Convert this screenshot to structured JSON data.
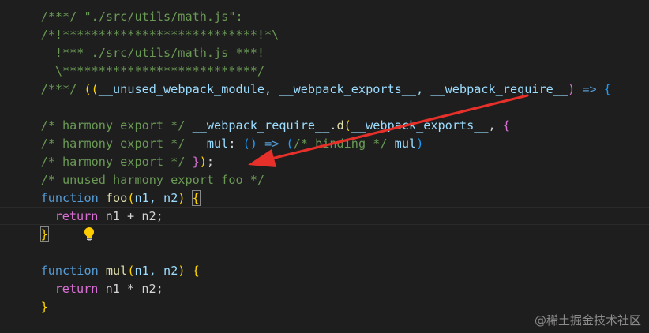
{
  "code": {
    "header_top": "/***/ \"./src/utils/math.js\":",
    "banner_1": "/*!***************************!*\\",
    "banner_2": "  !*** ./src/utils/math.js ***!",
    "banner_3": "  \\***************************/",
    "module_fn": {
      "prefix": "/***/ ",
      "open_parens": "((",
      "params": "__unused_webpack_module, __webpack_exports__, __webpack_require__",
      "close_paren": ")",
      "arrow": " => ",
      "brace": "{"
    },
    "export_1": {
      "comment": "/* harmony export */ ",
      "obj": "__webpack_require__",
      "dot": ".",
      "method": "d",
      "open": "(",
      "arg": "__webpack_exports__",
      "comma": ", ",
      "brace": "{"
    },
    "export_2": {
      "comment": "/* harmony export */   ",
      "key": "mul",
      "colon": ": ",
      "parens": "()",
      "arrow": " => ",
      "open": "(",
      "binding_comment": "/* binding */ ",
      "value": "mul",
      "close": ")"
    },
    "export_3": {
      "comment": "/* harmony export */ ",
      "brace": "}",
      "paren": ")",
      "semicolon": ";"
    },
    "unused_comment": "/* unused harmony export foo */",
    "foo_fn": {
      "keyword": "function",
      "name": "foo",
      "open": "(",
      "params": "n1, n2",
      "close": ")",
      "brace": "{"
    },
    "foo_return": {
      "keyword": "return",
      "expr_a": " n1 ",
      "op": "+",
      "expr_b": " n2;"
    },
    "foo_close": "}",
    "mul_fn": {
      "keyword": "function",
      "name": "mul",
      "open": "(",
      "params": "n1, n2",
      "close": ")",
      "brace": "{"
    },
    "mul_return": {
      "keyword": "return",
      "expr_a": " n1 ",
      "op": "*",
      "expr_b": " n2;"
    },
    "mul_close": "}"
  },
  "lightbulb_icon": "lightbulb-icon",
  "annotation_arrow": "arrow",
  "watermark": "@稀土掘金技术社区",
  "colors": {
    "background": "#1e1e1e",
    "comment": "#6a9955",
    "keyword": "#569cd6",
    "function": "#dcdcaa",
    "identifier": "#9cdcfe",
    "arrow": "#e8302a"
  }
}
